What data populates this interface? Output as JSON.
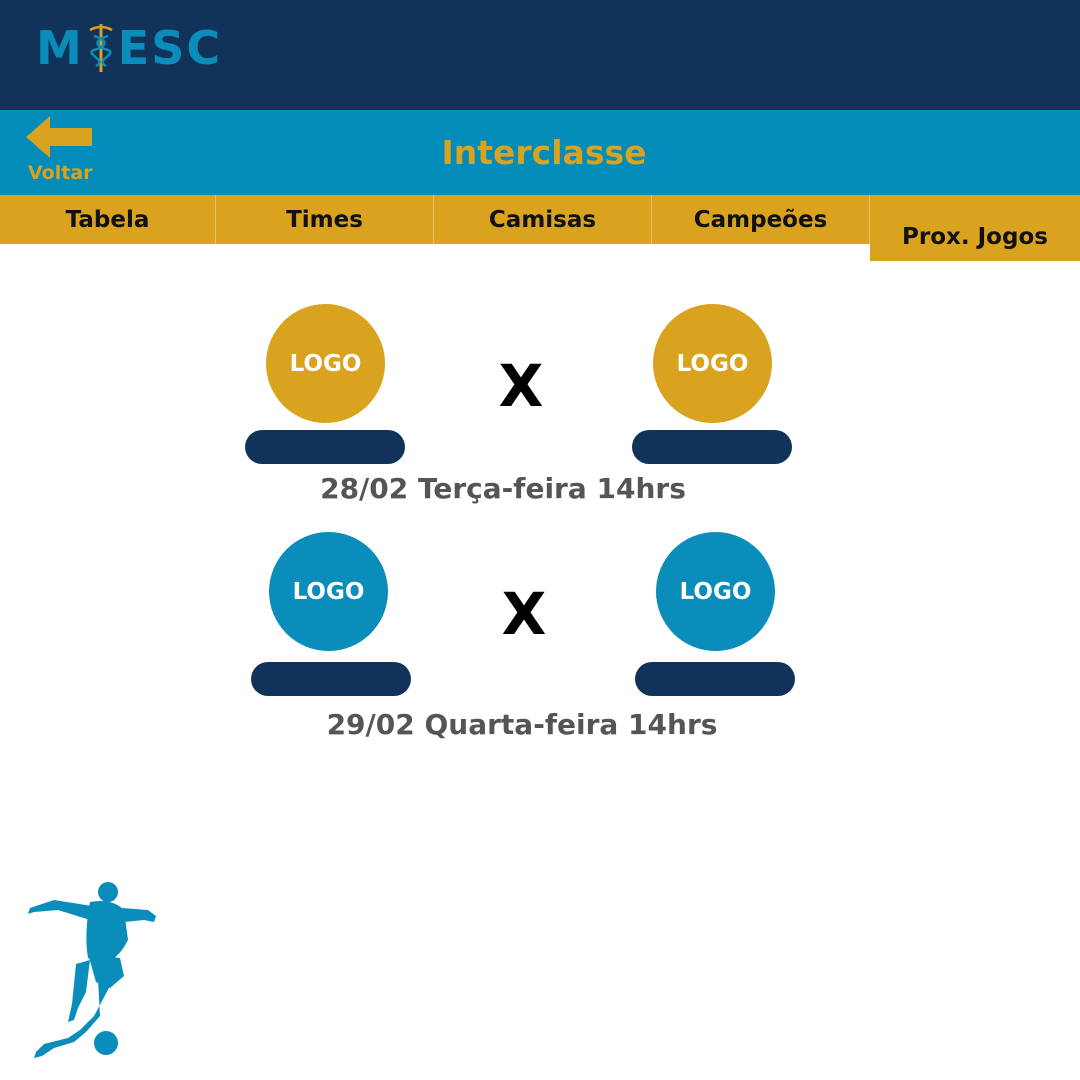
{
  "brand": {
    "logo_text": "MIESC",
    "logo_left": "M",
    "logo_right": "ESC"
  },
  "header": {
    "back_label": "Voltar",
    "title": "Interclasse"
  },
  "tabs": [
    {
      "label": "Tabela"
    },
    {
      "label": "Times"
    },
    {
      "label": "Camisas"
    },
    {
      "label": "Campeões"
    },
    {
      "label": "Prox. Jogos",
      "active": true
    }
  ],
  "matches": [
    {
      "home_logo": "LOGO",
      "away_logo": "LOGO",
      "versus": "X",
      "date": "28/02 Terça-feira 14hrs",
      "logo_color": "#d9a21f"
    },
    {
      "home_logo": "LOGO",
      "away_logo": "LOGO",
      "versus": "X",
      "date": "29/02 Quarta-feira 14hrs",
      "logo_color": "#0a8dbb"
    }
  ],
  "colors": {
    "navy": "#11335a",
    "blue": "#028cb9",
    "gold": "#d9a21f",
    "date_text": "#555555"
  },
  "icons": {
    "back": "left-arrow-icon",
    "decoration": "soccer-player-icon"
  }
}
